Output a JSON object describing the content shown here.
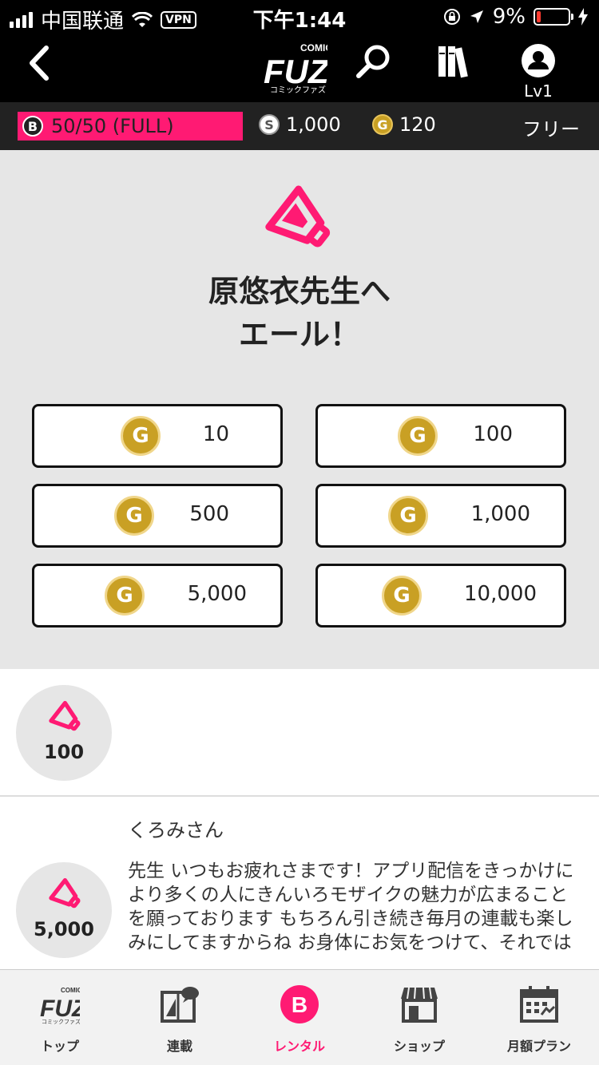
{
  "status_bar": {
    "carrier": "中国联通",
    "vpn": "VPN",
    "time": "下午1:44",
    "battery": "9%"
  },
  "header": {
    "logo_top": "COMIC",
    "logo_main": "FUZ",
    "logo_sub": "コミックファズ",
    "level": "Lv1",
    "icons": [
      "back-icon",
      "search-icon",
      "bookshelf-icon",
      "user-icon"
    ]
  },
  "points": {
    "b_letter": "B",
    "b_value": "50/50 (FULL)",
    "s_letter": "S",
    "s_value": "1,000",
    "g_letter": "G",
    "g_value": "120",
    "plan": "フリー"
  },
  "hero": {
    "title_line1": "原悠衣先生へ",
    "title_line2": "エール！",
    "coin_letter": "G",
    "amounts": [
      "10",
      "100",
      "500",
      "1,000",
      "5,000",
      "10,000"
    ]
  },
  "feed": {
    "items": [
      {
        "amount": "100",
        "user": "",
        "comment": ""
      },
      {
        "amount": "5,000",
        "user": "くろみさん",
        "comment": "先生 いつもお疲れさまです！アプリ配信をきっかけにより多くの人にきんいろモザイクの魅力が広まることを願っております もちろん引き続き毎月の連載も楽しみにしてますからね お身体にお気をつけて、それでは"
      }
    ]
  },
  "tabbar": {
    "tabs": [
      {
        "label": "トップ",
        "icon": "fuz-logo-icon"
      },
      {
        "label": "連載",
        "icon": "magazine-chat-icon"
      },
      {
        "label": "レンタル",
        "icon": "rental-b-icon",
        "active": true
      },
      {
        "label": "ショップ",
        "icon": "shop-icon"
      },
      {
        "label": "月額プラン",
        "icon": "calendar-icon"
      }
    ],
    "active_color": "#ff1a73"
  },
  "colors": {
    "accent": "#ff1a73",
    "gold": "#c9a024",
    "hero_bg": "#e6e6e6"
  }
}
